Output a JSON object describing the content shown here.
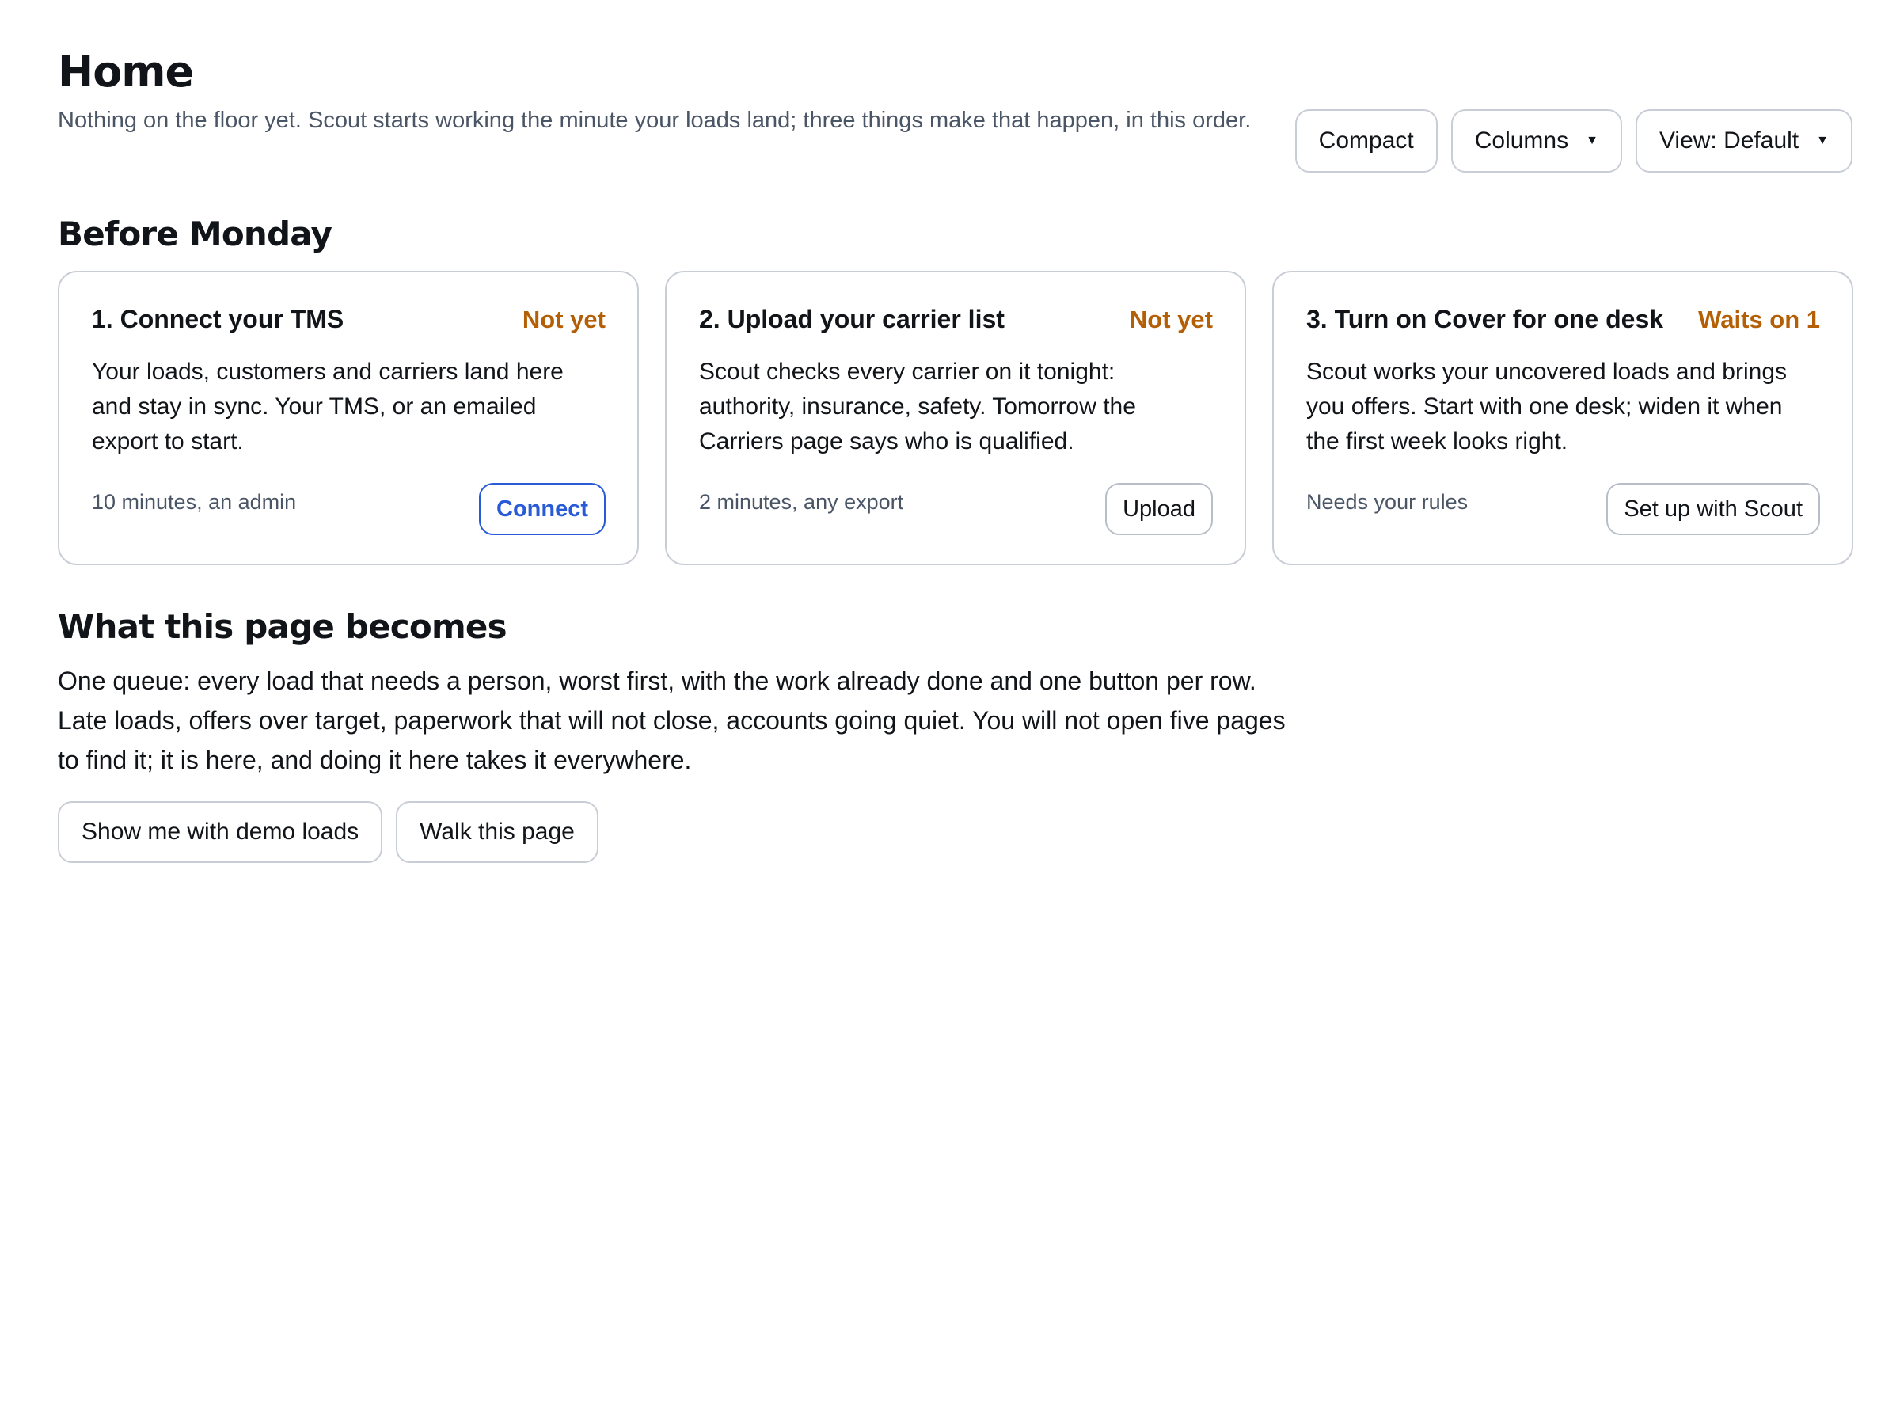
{
  "header": {
    "title": "Home",
    "subtitle": "Nothing on the floor yet. Scout starts working the minute your loads land; three things make that happen, in this order."
  },
  "toolbar": {
    "compact_label": "Compact",
    "columns_label": "Columns",
    "view_label": "View: Default"
  },
  "before_monday": {
    "heading": "Before Monday",
    "cards": [
      {
        "title": "1. Connect your TMS",
        "status": "Not yet",
        "body": "Your loads, customers and carriers land here and stay in sync. Your TMS, or an emailed export to start.",
        "meta": "10 minutes, an admin",
        "button": "Connect"
      },
      {
        "title": "2. Upload your carrier list",
        "status": "Not yet",
        "body": "Scout checks every carrier on it tonight: authority, insurance, safety. Tomorrow the Carriers page says who is qualified.",
        "meta": "2 minutes, any export",
        "button": "Upload"
      },
      {
        "title": "3. Turn on Cover for one desk",
        "status": "Waits on 1",
        "body": "Scout works your uncovered loads and brings you offers. Start with one desk; widen it when the first week looks right.",
        "meta": "Needs your rules",
        "button": "Set up with Scout"
      }
    ]
  },
  "future": {
    "heading": "What this page becomes",
    "body": "One queue: every load that needs a person, worst first, with the work already done and one button per row. Late loads, offers over target, paperwork that will not close, accounts going quiet. You will not open five pages to find it; it is here, and doing it here takes it everywhere.",
    "demo_button": "Show me with demo loads",
    "walk_button": "Walk this page"
  },
  "icons": {
    "dropdown": "caret-down-icon"
  },
  "colors": {
    "status": "#b45f06",
    "primary": "#2a5bd7",
    "border": "#c9ced6"
  }
}
